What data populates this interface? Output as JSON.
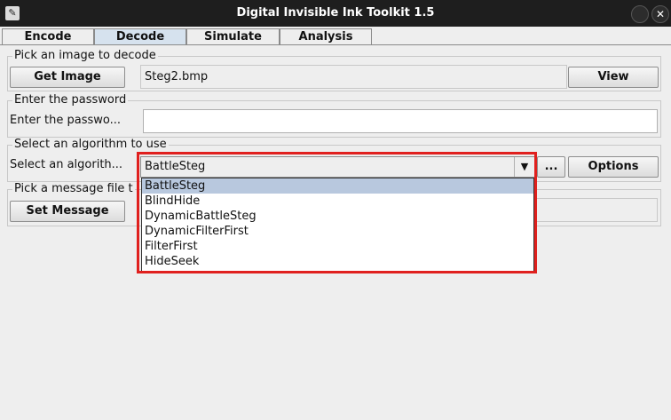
{
  "window": {
    "title": "Digital Invisible Ink Toolkit 1.5"
  },
  "tabs": [
    "Encode",
    "Decode",
    "Simulate",
    "Analysis"
  ],
  "image_group": {
    "title": "Pick an image to decode",
    "get_image_label": "Get Image",
    "filename": "Steg2.bmp",
    "view_label": "View"
  },
  "password_group": {
    "title": "Enter the password",
    "label": "Enter the passwo...",
    "value": ""
  },
  "algorithm_group": {
    "title": "Select an algorithm to use",
    "label": "Select an algorith...",
    "selected": "BattleSteg",
    "more_label": "...",
    "options_label": "Options",
    "options": [
      "BattleSteg",
      "BlindHide",
      "DynamicBattleSteg",
      "DynamicFilterFirst",
      "FilterFirst",
      "HideSeek"
    ]
  },
  "message_group": {
    "title": "Pick a message file t",
    "set_message_label": "Set Message"
  },
  "colors": {
    "highlight": "#e0201e",
    "selected_option": "#b8c8de",
    "active_tab": "#d6e2ee"
  }
}
